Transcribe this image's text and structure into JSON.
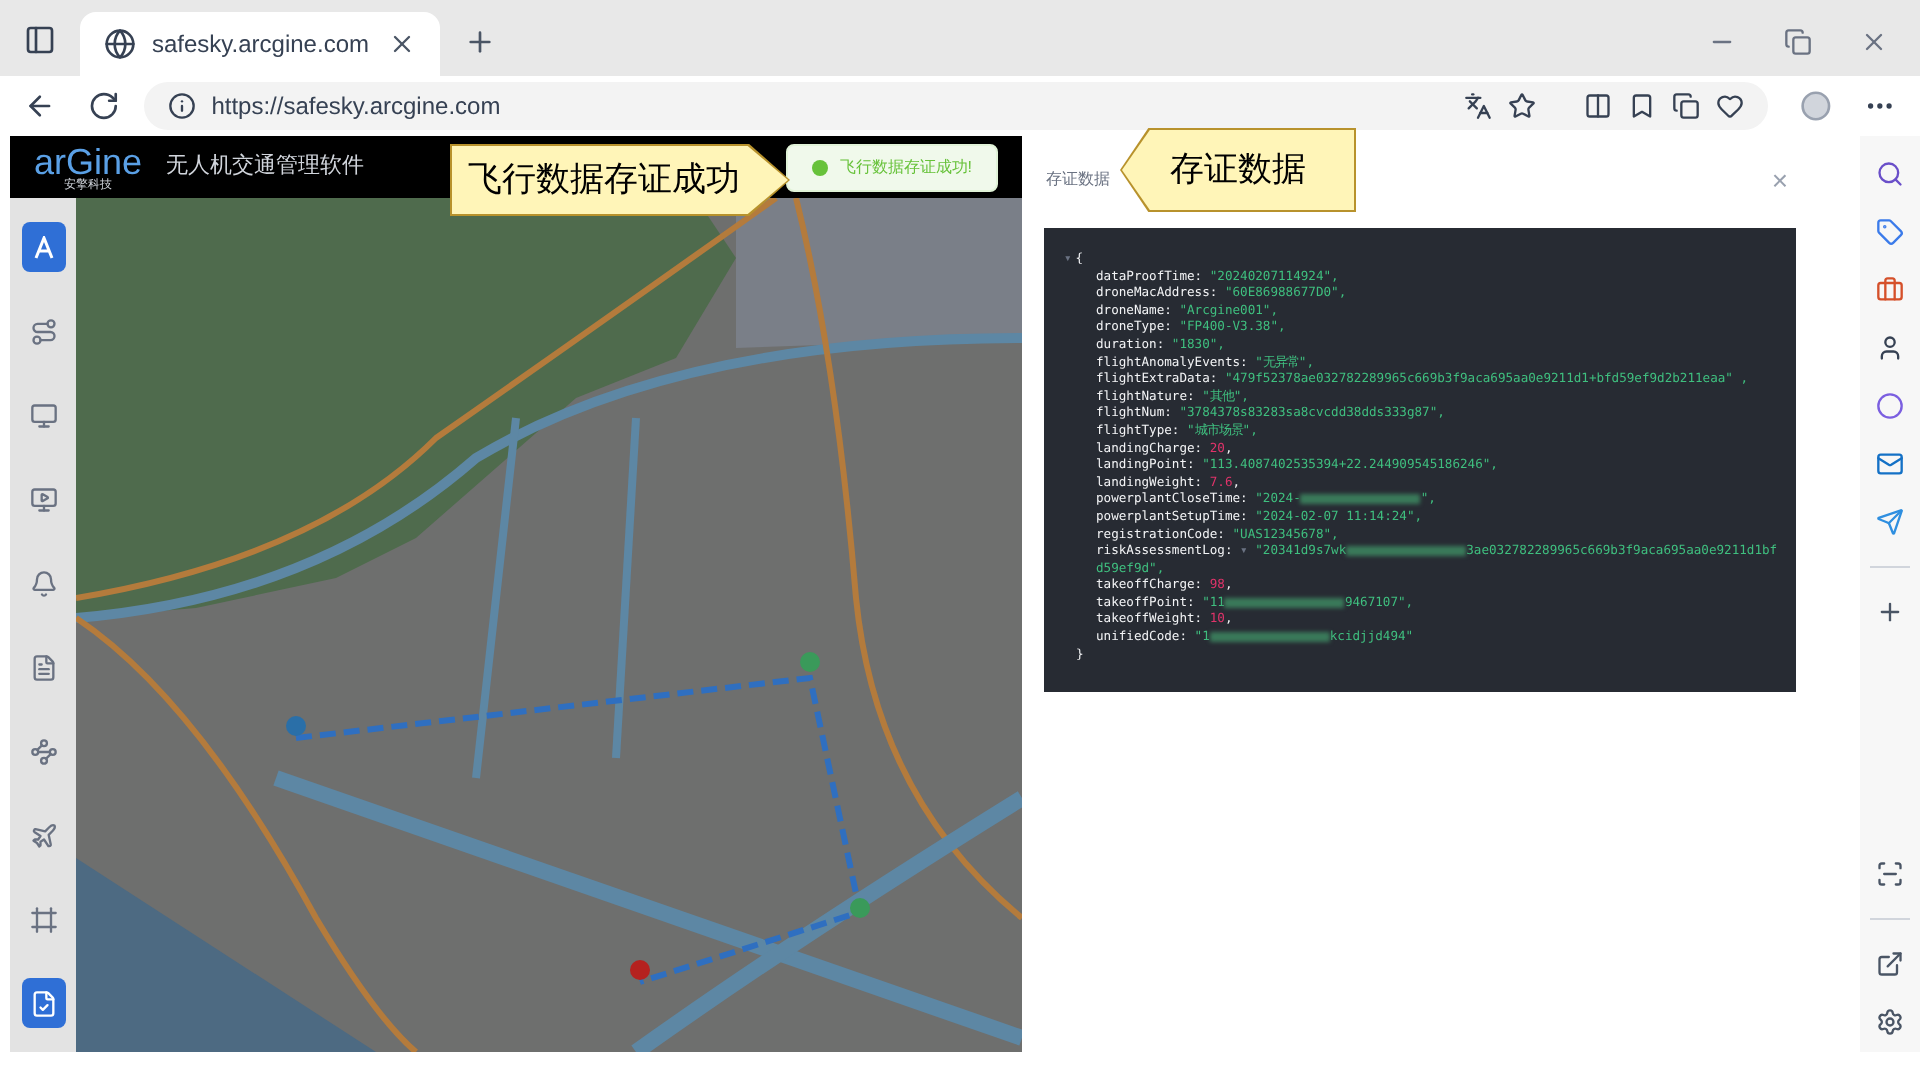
{
  "browser": {
    "tab_title": "safesky.arcgine.com",
    "url": "https://safesky.arcgine.com"
  },
  "app": {
    "logo": "arGine",
    "logo_sub": "安擎科技",
    "title": "无人机交通管理软件",
    "toast": "飞行数据存证成功!"
  },
  "nav_items": [
    {
      "selected": true
    },
    {
      "selected": false
    },
    {
      "selected": false
    },
    {
      "selected": false
    },
    {
      "selected": false
    },
    {
      "selected": false
    },
    {
      "selected": false
    },
    {
      "selected": false
    },
    {
      "selected": false
    },
    {
      "selected": true
    }
  ],
  "callouts": [
    {
      "text": "飞行数据存证成功",
      "kind": "right"
    },
    {
      "text": "存证数据",
      "kind": "left"
    }
  ],
  "panel": {
    "title": "存证数据",
    "close": "×",
    "toggle": "▾",
    "open": "{",
    "close_brace": "}",
    "lines": [
      {
        "key": "dataProofTime:",
        "value": "\"20240207114924\",",
        "kind": "string"
      },
      {
        "key": "droneMacAddress:",
        "value": "\"60E86988677D0\",",
        "kind": "string"
      },
      {
        "key": "droneName:",
        "value": "\"Arcgine001\",",
        "kind": "string"
      },
      {
        "key": "droneType:",
        "value": "\"FP400-V3.38\",",
        "kind": "string"
      },
      {
        "key": "duration:",
        "value": "\"1830\",",
        "kind": "string"
      },
      {
        "key": "flightAnomalyEvents:",
        "value": "\"无异常\",",
        "kind": "string"
      },
      {
        "key": "flightExtraData:",
        "value": "\"479f52378ae032782289965c669b3f9aca695aa0e9211d1+bfd59ef9d2b211eaa\" ,",
        "kind": "string"
      },
      {
        "key": "flightNature:",
        "value": "\"其他\",",
        "kind": "string"
      },
      {
        "key": "flightNum:",
        "value": "\"3784378s83283sa8cvcdd38dds333g87\",",
        "kind": "string"
      },
      {
        "key": "flightType:",
        "value": "\"城市场景\",",
        "kind": "string"
      },
      {
        "key": "landingCharge:",
        "value": "20",
        "end": ",",
        "kind": "number"
      },
      {
        "key": "landingPoint:",
        "value": "\"113.4087402535394+22.244909545186246\",",
        "kind": "string"
      },
      {
        "key": "landingWeight:",
        "value": "7.6",
        "end": ",",
        "kind": "number"
      },
      {
        "key": "powerplantCloseTime:",
        "value": "\"2024-",
        "value_end": "\",",
        "kind": "redacted"
      },
      {
        "key": "powerplantSetupTime:",
        "value": "\"2024-02-07 11:14:24\",",
        "kind": "string"
      },
      {
        "key": "registrationCode:",
        "value": "\"UAS12345678\",",
        "kind": "string"
      },
      {
        "key": "riskAssessmentLog:",
        "value": "\"20341d9s7wk",
        "value_end": "3ae032782289965c669b3f9aca695aa0e9211d1bfd59ef9d\",",
        "kind": "redacted",
        "collapsible": true
      },
      {
        "key": "takeoffCharge:",
        "value": "98",
        "end": ",",
        "kind": "number"
      },
      {
        "key": "takeoffPoint:",
        "value": "\"11",
        "value_end": "9467107\",",
        "kind": "redacted"
      },
      {
        "key": "takeoffWeight:",
        "value": "10",
        "end": ",",
        "kind": "number"
      },
      {
        "key": "unifiedCode:",
        "value": "\"1",
        "value_end": "kcidjjd494\"",
        "kind": "redacted"
      }
    ]
  }
}
